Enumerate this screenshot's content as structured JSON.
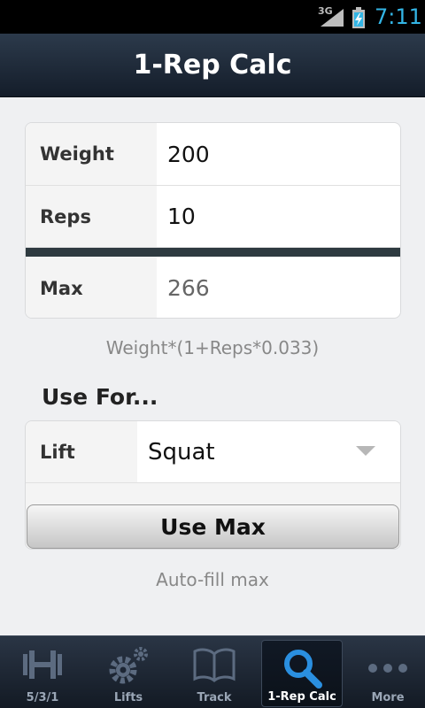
{
  "status_bar": {
    "network": "3G",
    "time": "7:11"
  },
  "header": {
    "title": "1-Rep Calc"
  },
  "calculator": {
    "weight": {
      "label": "Weight",
      "value": "200"
    },
    "reps": {
      "label": "Reps",
      "value": "10"
    },
    "max": {
      "label": "Max",
      "value": "266"
    },
    "formula": "Weight*(1+Reps*0.033)"
  },
  "use_for": {
    "title": "Use For...",
    "lift_label": "Lift",
    "lift_value": "Squat",
    "button_label": "Use Max",
    "hint": "Auto-fill max"
  },
  "tabs": [
    {
      "label": "5/3/1",
      "icon": "dumbbell-icon",
      "active": false
    },
    {
      "label": "Lifts",
      "icon": "gears-icon",
      "active": false
    },
    {
      "label": "Track",
      "icon": "book-icon",
      "active": false
    },
    {
      "label": "1-Rep Calc",
      "icon": "search-icon",
      "active": true
    },
    {
      "label": "More",
      "icon": "more-dots-icon",
      "active": false
    }
  ],
  "colors": {
    "accent": "#33b5e5",
    "header_bg": "#1f2a38",
    "active_icon": "#2a8fe0"
  }
}
